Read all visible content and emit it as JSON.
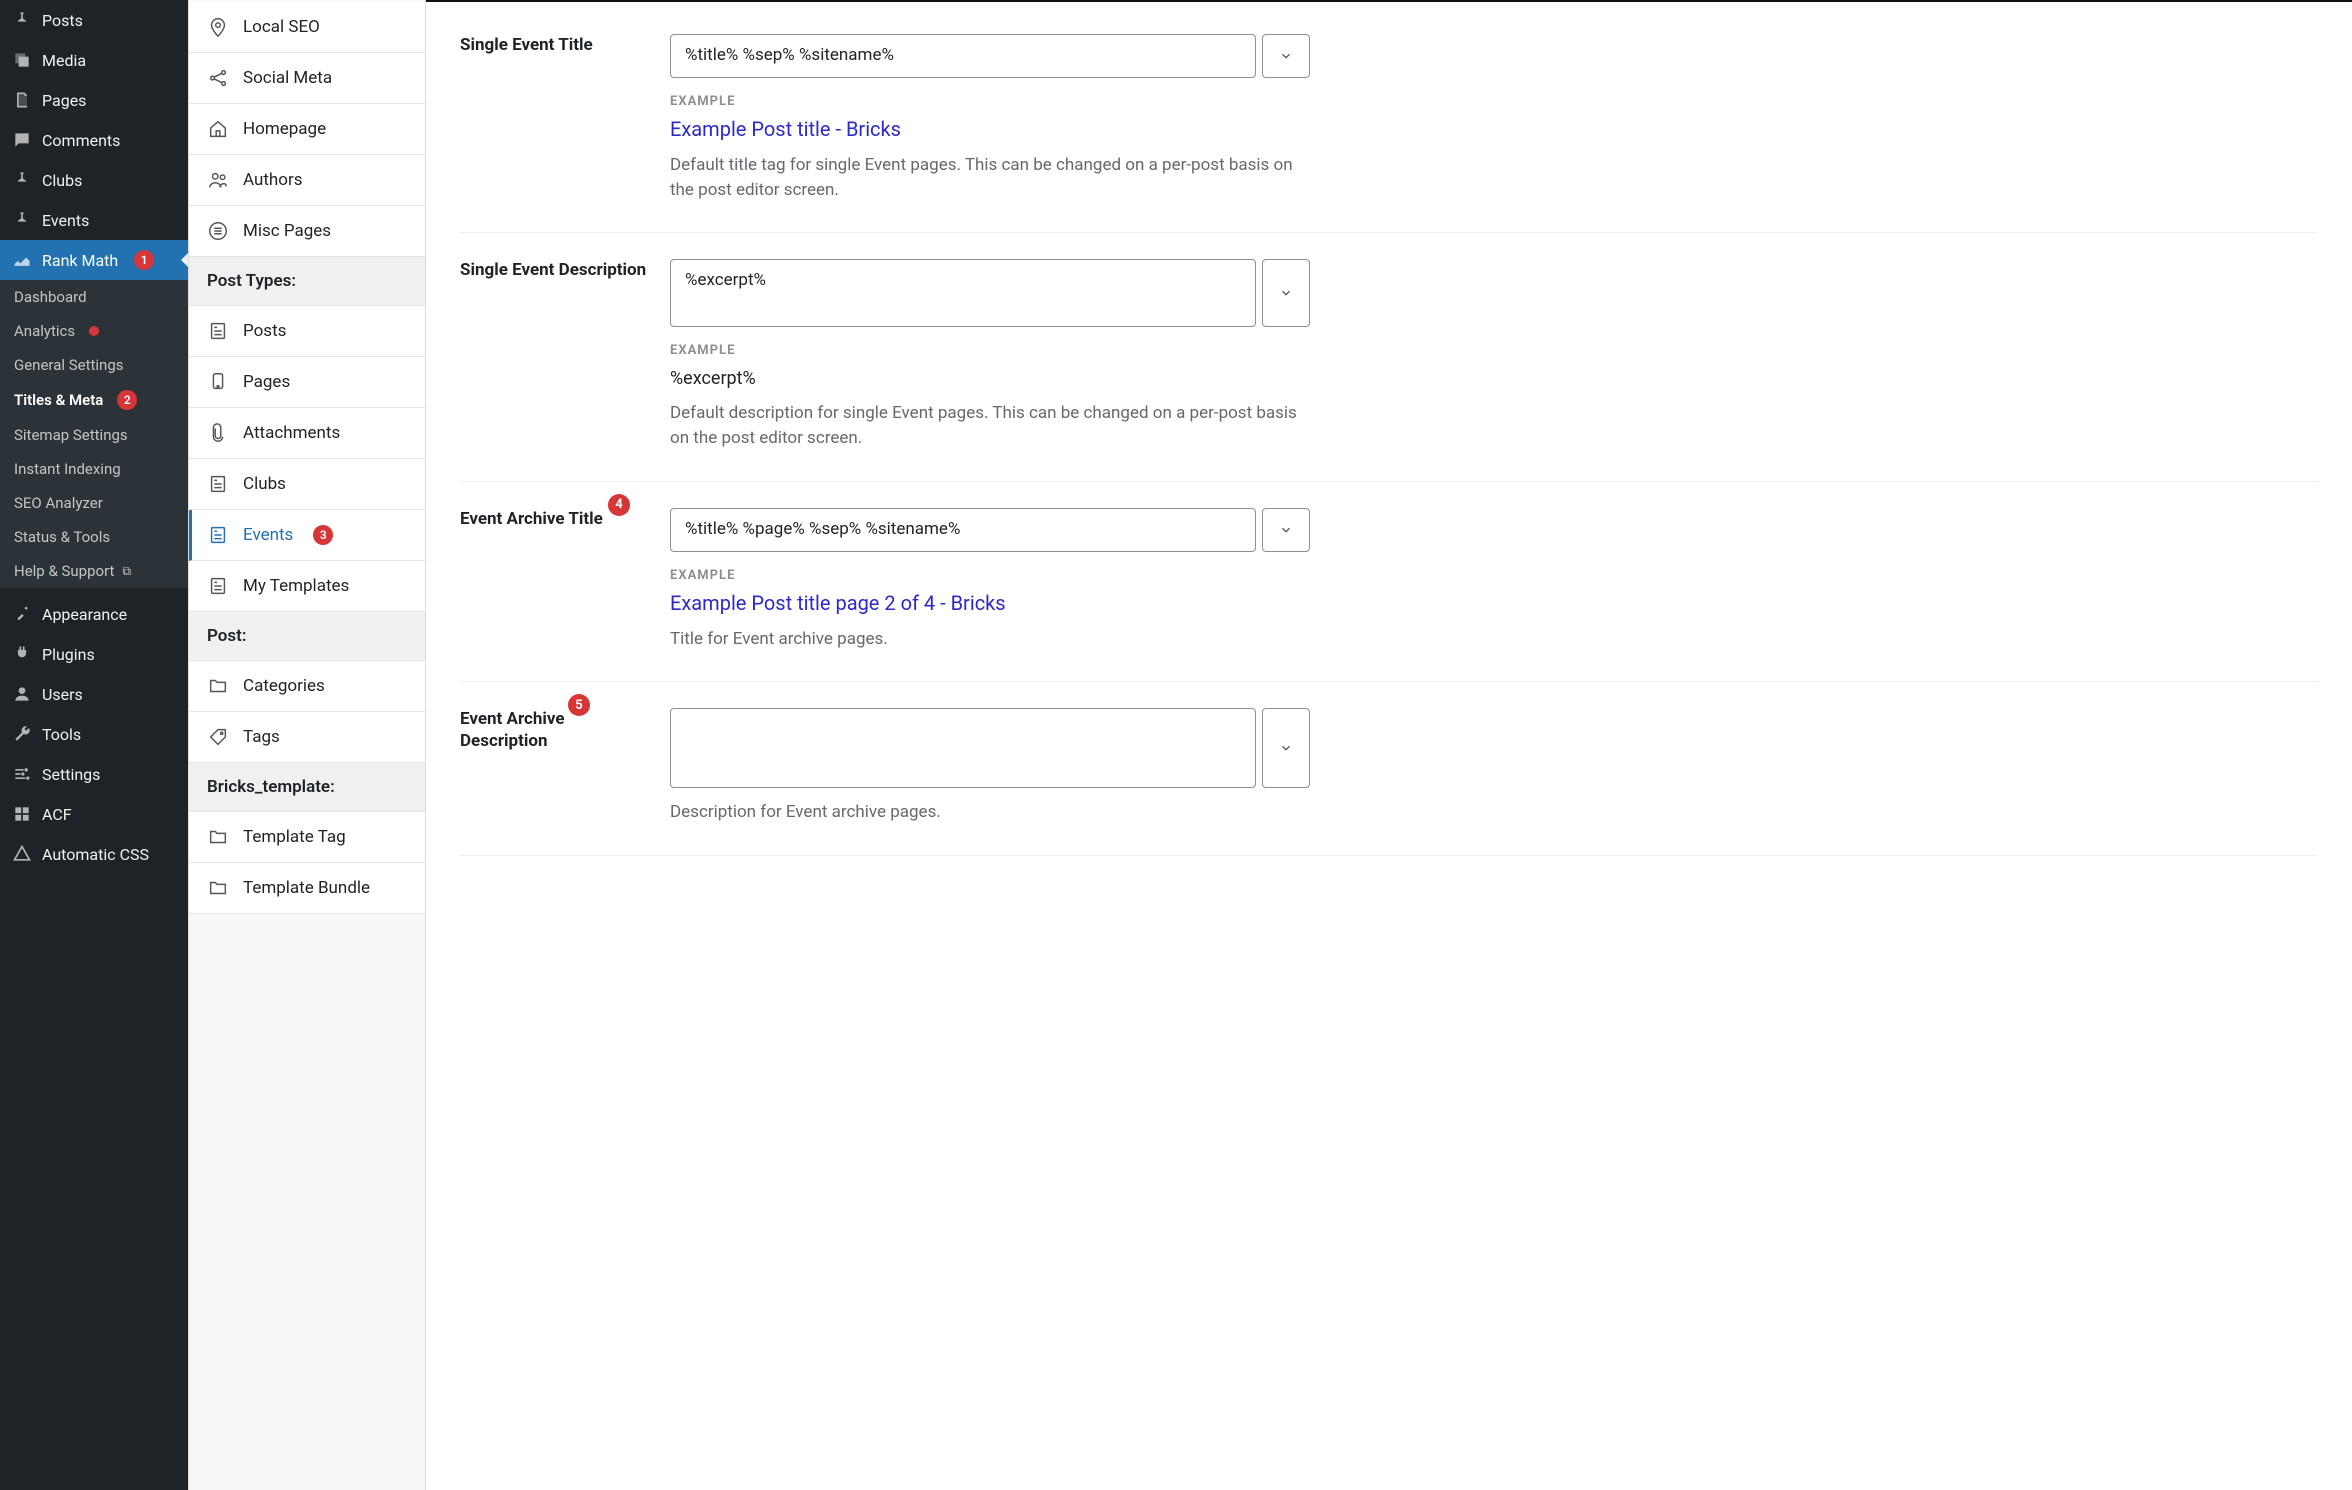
{
  "wp_menu": {
    "posts": "Posts",
    "media": "Media",
    "pages": "Pages",
    "comments": "Comments",
    "clubs": "Clubs",
    "events": "Events",
    "rank_math": "Rank Math",
    "appearance": "Appearance",
    "plugins": "Plugins",
    "users": "Users",
    "tools": "Tools",
    "settings": "Settings",
    "acf": "ACF",
    "automatic_css": "Automatic CSS"
  },
  "rank_math_badge": "1",
  "rm_submenu": {
    "dashboard": "Dashboard",
    "analytics": "Analytics",
    "general_settings": "General Settings",
    "titles_meta": "Titles & Meta",
    "titles_meta_badge": "2",
    "sitemap_settings": "Sitemap Settings",
    "instant_indexing": "Instant Indexing",
    "seo_analyzer": "SEO Analyzer",
    "status_tools": "Status & Tools",
    "help_support": "Help & Support"
  },
  "tabs": {
    "local_seo": "Local SEO",
    "social_meta": "Social Meta",
    "homepage": "Homepage",
    "authors": "Authors",
    "misc_pages": "Misc Pages",
    "section_post_types": "Post Types:",
    "posts": "Posts",
    "pages": "Pages",
    "attachments": "Attachments",
    "clubs": "Clubs",
    "events": "Events",
    "events_badge": "3",
    "my_templates": "My Templates",
    "section_post": "Post:",
    "categories": "Categories",
    "tags": "Tags",
    "section_bricks": "Bricks_template:",
    "template_tag": "Template Tag",
    "template_bundle": "Template Bundle"
  },
  "fields": {
    "single_title": {
      "label": "Single Event Title",
      "value": "%title% %sep% %sitename%",
      "example_label": "EXAMPLE",
      "example": "Example Post title - Bricks",
      "help": "Default title tag for single Event pages. This can be changed on a per-post basis on the post editor screen."
    },
    "single_desc": {
      "label": "Single Event Description",
      "value": "%excerpt%",
      "example_label": "EXAMPLE",
      "example": "%excerpt%",
      "help": "Default description for single Event pages. This can be changed on a per-post basis on the post editor screen."
    },
    "archive_title": {
      "label": "Event Archive Title",
      "badge": "4",
      "value": "%title% %page% %sep% %sitename%",
      "example_label": "EXAMPLE",
      "example": "Example Post title page 2 of 4 - Bricks",
      "help": "Title for Event archive pages."
    },
    "archive_desc": {
      "label": "Event Archive Description",
      "badge": "5",
      "value": "",
      "help": "Description for Event archive pages."
    }
  }
}
